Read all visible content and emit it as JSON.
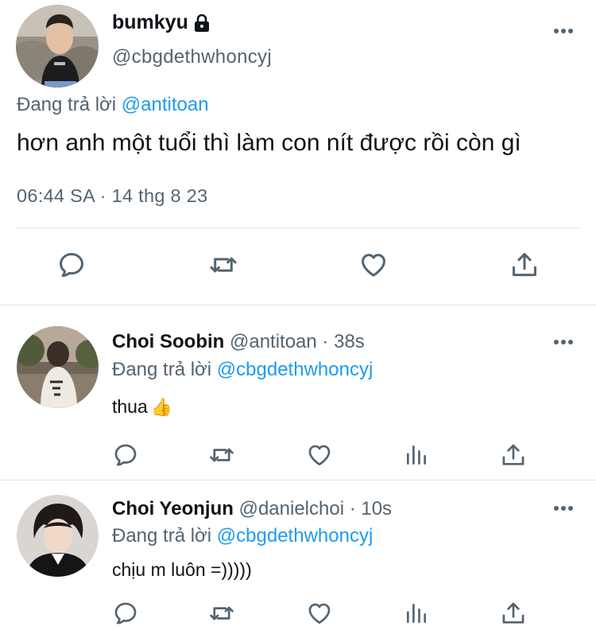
{
  "main_tweet": {
    "display_name": "bumkyu",
    "handle": "@cbgdethwhoncyj",
    "reply_prefix": "Đang trả lời ",
    "reply_to": "@antitoan",
    "text": "hơn anh một tuổi thì làm con nít được rồi còn gì",
    "timestamp": "06:44 SA · 14 thg 8 23",
    "actions": [
      "reply-icon",
      "retweet-icon",
      "like-icon",
      "share-icon"
    ]
  },
  "replies": [
    {
      "display_name": "Choi Soobin",
      "handle": "@antitoan",
      "time": " · 38s",
      "reply_prefix": "Đang trả lời ",
      "reply_to": "@cbgdethwhoncyj",
      "text": "thua",
      "emoji": "👍",
      "actions": [
        "reply-icon",
        "retweet-icon",
        "like-icon",
        "analytics-icon",
        "share-icon"
      ]
    },
    {
      "display_name": "Choi Yeonjun",
      "handle": "@danielchoi",
      "time": " · 10s",
      "reply_prefix": "Đang trả lời ",
      "reply_to": "@cbgdethwhoncyj",
      "text": "chịu m luôn =)))))",
      "actions": [
        "reply-icon",
        "retweet-icon",
        "like-icon",
        "analytics-icon",
        "share-icon"
      ]
    }
  ],
  "colors": {
    "text_primary": "#0f1419",
    "text_secondary": "#536471",
    "accent": "#1d9bf0",
    "divider": "#dfe3e6"
  }
}
